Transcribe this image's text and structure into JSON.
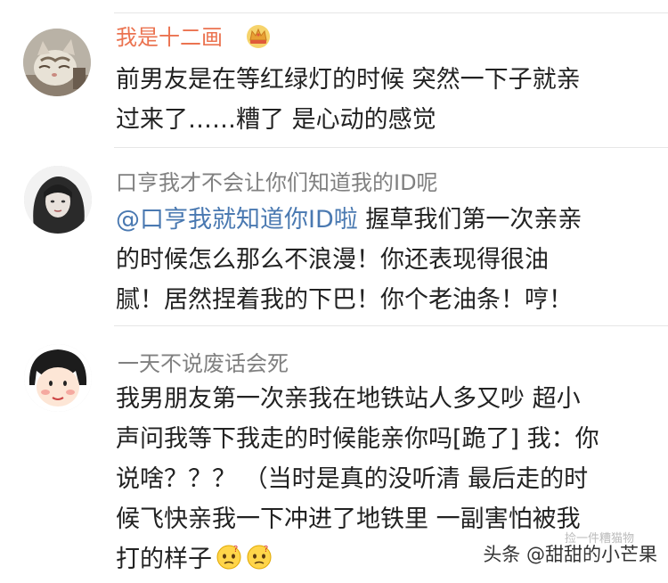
{
  "comments": [
    {
      "username": "我是十二画",
      "badge_icon": "crown-icon",
      "avatar": "cat-avatar",
      "lines": [
        "前男友是在等红绿灯的时候 突然一下子就亲",
        "过来了……糟了 是心动的感觉"
      ]
    },
    {
      "username": "口亨我才不会让你们知道我的ID呢",
      "avatar": "girl-avatar",
      "mention": "@口亨我就知道你ID啦",
      "lines": [
        " 握草我们第一次亲亲",
        "的时候怎么那么不浪漫！你还表现得很油",
        "腻！居然捏着我的下巴！你个老油条！哼！"
      ]
    },
    {
      "username": "一天不说废话会死",
      "avatar": "cartoon-girl-avatar",
      "lines": [
        "我男朋友第一次亲我在地铁站人多又吵 超小",
        "声问我等下我走的时候能亲你吗[跪了] 我：你",
        "说啥？？？ （当时是真的没听清 最后走的时",
        "候飞快亲我一下冲进了地铁里 一副害怕被我",
        "打的样子"
      ],
      "trailing_icons": [
        "confused-emoji-icon",
        "confused-emoji-icon"
      ]
    }
  ],
  "watermark": {
    "main": "头条 @甜甜的小芒果",
    "faint": "捡一件糟猫物"
  },
  "colors": {
    "username_highlight": "#eb7350",
    "username_default": "#808080",
    "mention": "#4a79b1",
    "text": "#222222"
  }
}
